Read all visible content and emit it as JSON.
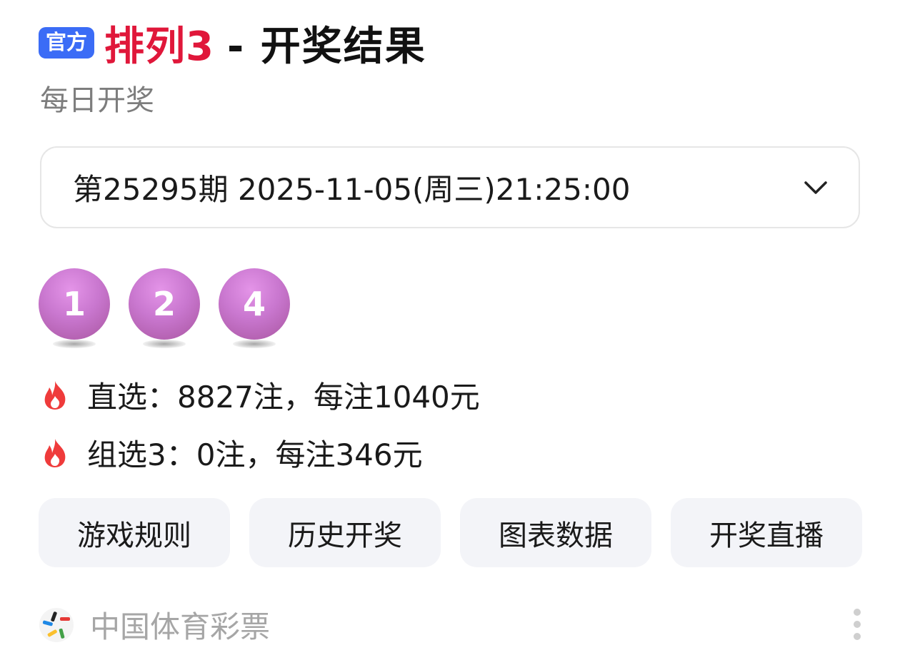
{
  "header": {
    "badge": "官方",
    "title_game": "排列3",
    "title_rest": "- 开奖结果",
    "subtitle": "每日开奖"
  },
  "draw_selector": {
    "text": "第25295期 2025-11-05(周三)21:25:00",
    "icon": "chevron-down-icon"
  },
  "balls": [
    "1",
    "2",
    "4"
  ],
  "prizes": [
    {
      "icon": "fire-icon",
      "text": "直选：8827注，每注1040元"
    },
    {
      "icon": "fire-icon",
      "text": "组选3：0注，每注346元"
    }
  ],
  "actions": [
    {
      "label": "游戏规则"
    },
    {
      "label": "历史开奖"
    },
    {
      "label": "图表数据"
    },
    {
      "label": "开奖直播"
    }
  ],
  "source": {
    "name": "中国体育彩票",
    "logo_icon": "china-sports-lottery-logo",
    "menu_icon": "more-vertical-icon"
  },
  "colors": {
    "badge_bg": "#3b6cf6",
    "title_red": "#e0173a",
    "ball": "#c977cf",
    "fire": "#ef3b3b",
    "button_bg": "#f3f4f8"
  }
}
